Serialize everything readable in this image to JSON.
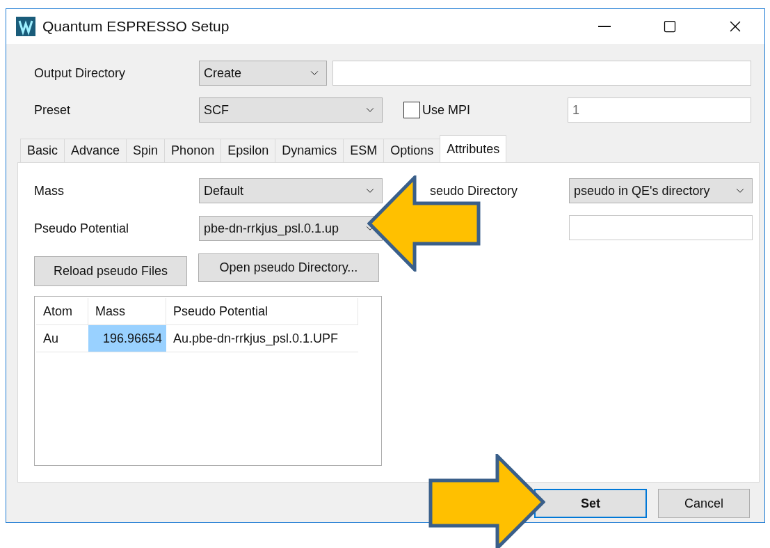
{
  "window": {
    "title": "Quantum ESPRESSO Setup"
  },
  "output_directory": {
    "label": "Output Directory",
    "mode": "Create"
  },
  "preset": {
    "label": "Preset",
    "value": "SCF"
  },
  "use_mpi": {
    "label": "Use MPI",
    "checked": false
  },
  "mpi_processes": {
    "value": "1",
    "disabled": true
  },
  "tabs": [
    {
      "label": "Basic",
      "selected": false
    },
    {
      "label": "Advance",
      "selected": false
    },
    {
      "label": "Spin",
      "selected": false
    },
    {
      "label": "Phonon",
      "selected": false
    },
    {
      "label": "Epsilon",
      "selected": false
    },
    {
      "label": "Dynamics",
      "selected": false
    },
    {
      "label": "ESM",
      "selected": false
    },
    {
      "label": "Options",
      "selected": false
    },
    {
      "label": "Attributes",
      "selected": true
    }
  ],
  "attributes": {
    "mass": {
      "label": "Mass",
      "value": "Default"
    },
    "pseudo_potential": {
      "label": "Pseudo Potential",
      "value": "pbe-dn-rrkjus_psl.0.1.up"
    },
    "pseudo_directory": {
      "label": "seudo Directory",
      "value": "pseudo in QE's directory"
    },
    "buttons": [
      "Reload pseudo Files",
      "Open pseudo Directory..."
    ],
    "table": {
      "columns": [
        "Atom",
        "Mass",
        "Pseudo Potential"
      ],
      "rows": [
        {
          "cells": [
            {
              "text": "Au",
              "selected": false
            },
            {
              "text": "196.96654",
              "selected": true
            },
            {
              "text": "Au.pbe-dn-rrkjus_psl.0.1.UPF",
              "selected": false
            }
          ]
        }
      ]
    }
  },
  "buttons": [
    {
      "label": "Set",
      "default": true
    },
    {
      "label": "Cancel",
      "default": false
    }
  ]
}
